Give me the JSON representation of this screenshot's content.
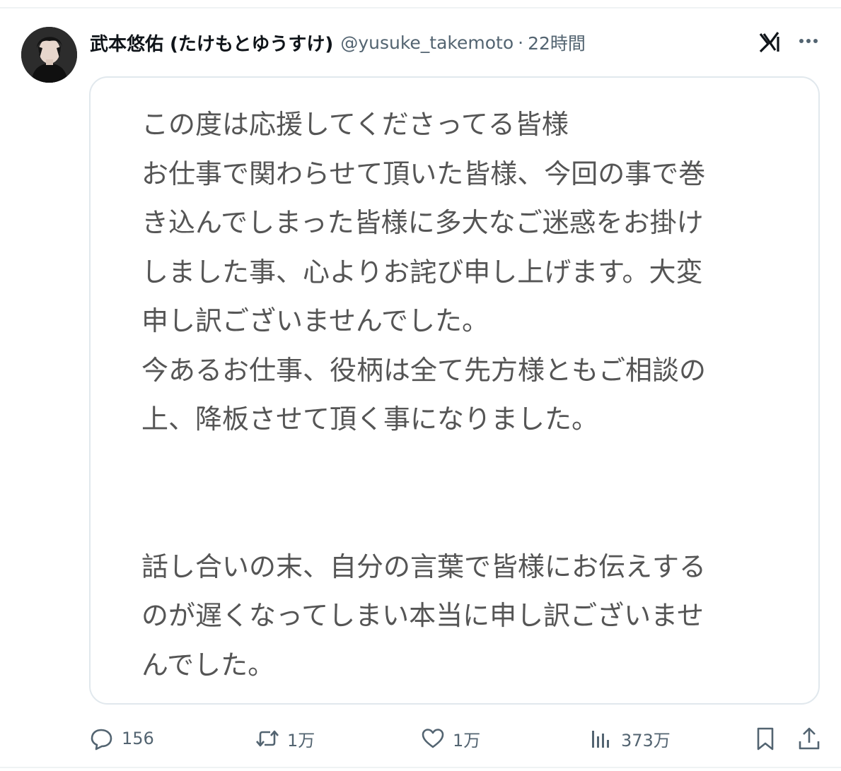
{
  "post": {
    "author": {
      "display_name": "武本悠佑 (たけもとゆうすけ)",
      "handle": "@yusuke_takemoto",
      "separator": "·",
      "timestamp": "22時間"
    },
    "image_text": "この度は応援してくださってる皆様\nお仕事で関わらせて頂いた皆様、今回の事で巻\nき込んでしまった皆様に多大なご迷惑をお掛け\nしました事、心よりお詫び申し上げます。大変\n申し訳ございませんでした。\n今あるお仕事、役柄は全て先方様ともご相談の\n上、降板させて頂く事になりました。\n\n\n話し合いの末、自分の言葉で皆様にお伝えする\nのが遅くなってしまい本当に申し訳ございませ\nんでした。",
    "actions": {
      "reply_count": "156",
      "retweet_count": "1万",
      "like_count": "1万",
      "view_count": "373万"
    },
    "icons": {
      "grok": "grok-icon",
      "more": "more-icon",
      "reply": "reply-icon",
      "retweet": "retweet-icon",
      "like": "heart-icon",
      "views": "views-icon",
      "bookmark": "bookmark-icon",
      "share": "share-icon"
    },
    "colors": {
      "text_primary": "#0f1419",
      "text_secondary": "#536471",
      "image_text": "#555555",
      "border": "#e1e8ed"
    }
  }
}
